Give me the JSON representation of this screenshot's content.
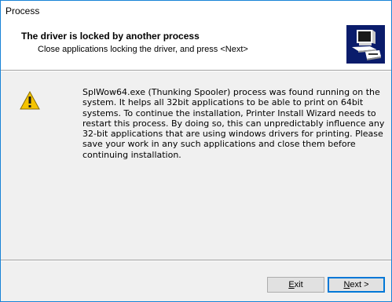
{
  "window": {
    "title": "Process"
  },
  "header": {
    "heading": "The driver is locked by another process",
    "subheading": "Close applications locking the driver, and press <Next>",
    "icon": "printer-computer-icon"
  },
  "message": {
    "icon": "warning-icon",
    "text": "SplWow64.exe (Thunking Spooler) process was found running on the system. It helps all 32bit applications to be able to print on 64bit systems. To continue the installation, Printer Install Wizard needs to restart this process. By doing so, this can unpredictably influence any 32-bit applications that are using windows drivers for printing. Please save your work in any such applications and close them before continuing installation."
  },
  "buttons": {
    "exit_mnemonic": "E",
    "exit_rest": "xit",
    "next_mnemonic": "N",
    "next_rest": "ext >"
  },
  "colors": {
    "accent": "#0078d7",
    "window_border": "#1883d7",
    "icon_bg": "#0a1c6b",
    "warning": "#f5c400"
  }
}
